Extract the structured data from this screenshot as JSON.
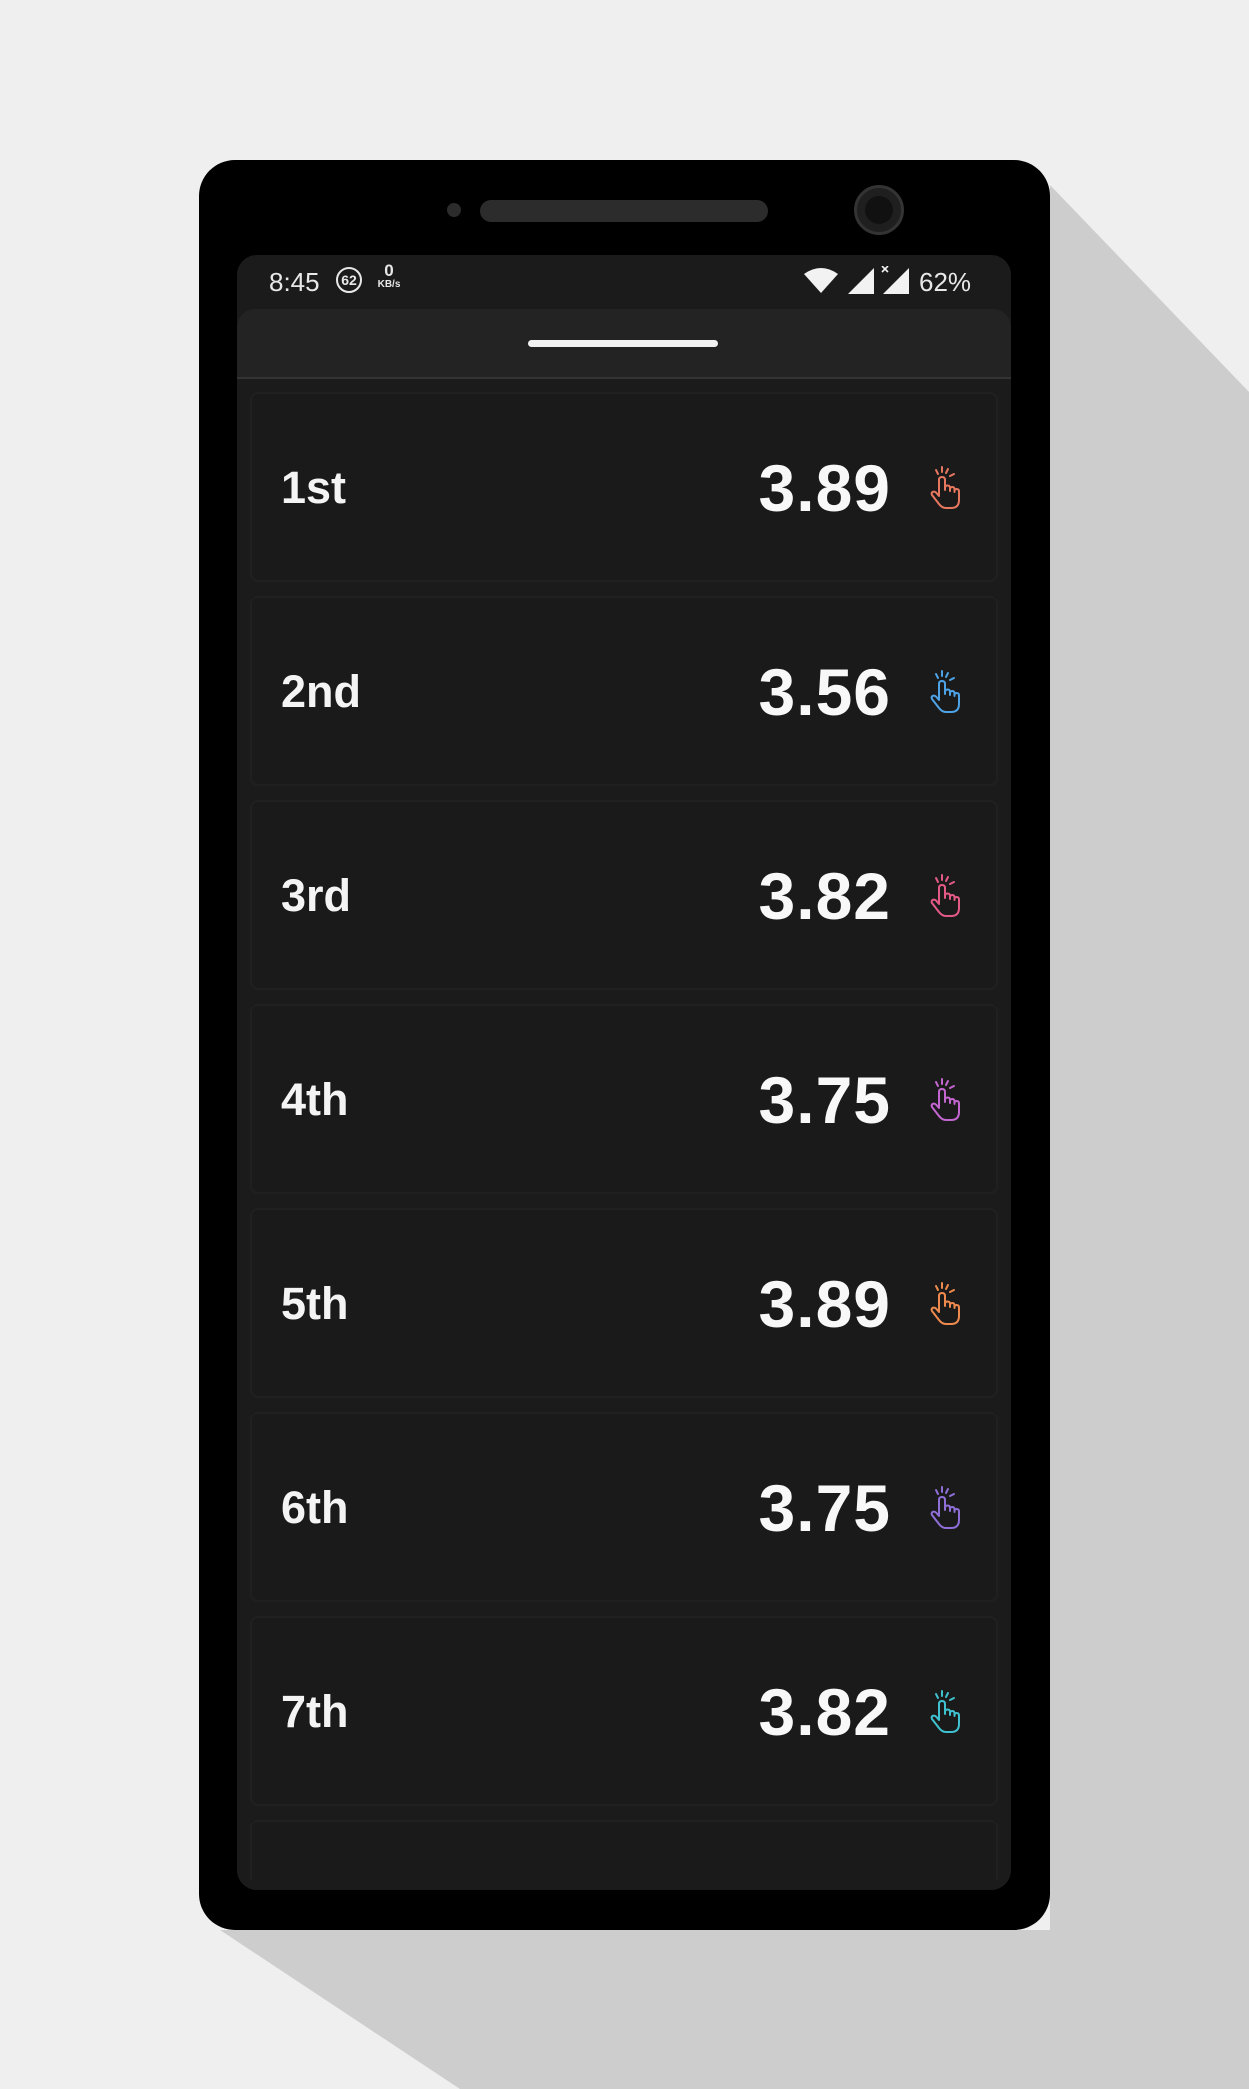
{
  "status_bar": {
    "time": "8:45",
    "badge_count": "62",
    "speed_value": "0",
    "speed_unit": "KB/s",
    "battery": "62%"
  },
  "list": {
    "items": [
      {
        "label": "1st",
        "value": "3.89",
        "icon": "tap-hand-icon",
        "color": "#e8775f"
      },
      {
        "label": "2nd",
        "value": "3.56",
        "icon": "tap-hand-icon",
        "color": "#4ea3e6"
      },
      {
        "label": "3rd",
        "value": "3.82",
        "icon": "tap-hand-icon",
        "color": "#e45a86"
      },
      {
        "label": "4th",
        "value": "3.75",
        "icon": "tap-hand-icon",
        "color": "#c466d0"
      },
      {
        "label": "5th",
        "value": "3.89",
        "icon": "tap-hand-icon",
        "color": "#ee8a4e"
      },
      {
        "label": "6th",
        "value": "3.75",
        "icon": "tap-hand-icon",
        "color": "#8f6ed8"
      },
      {
        "label": "7th",
        "value": "3.82",
        "icon": "tap-hand-icon",
        "color": "#3fc1cf"
      }
    ]
  }
}
